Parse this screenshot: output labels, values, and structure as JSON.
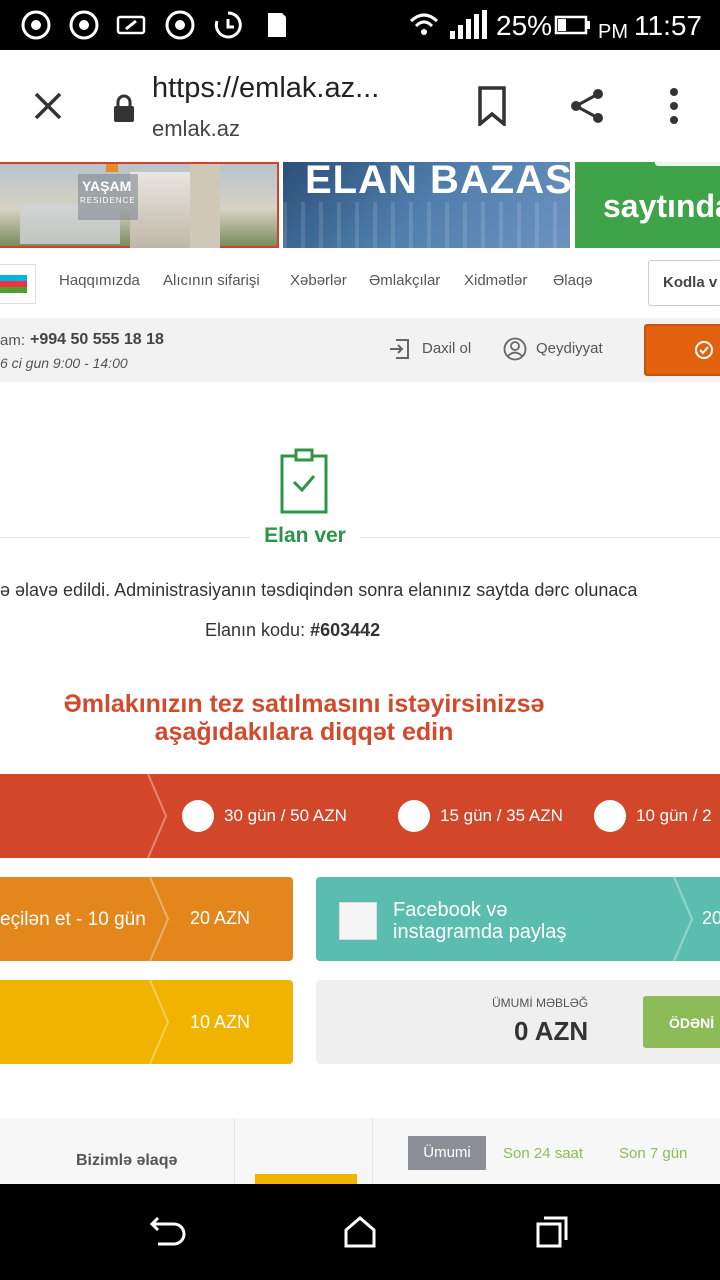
{
  "status_bar": {
    "battery": "25%",
    "ampm": "PM",
    "time": "11:57"
  },
  "browser": {
    "url": "https://emlak.az...",
    "domain": "emlak.az"
  },
  "banners": {
    "banner1_line1": "YAŞAM",
    "banner1_line2": "RESIDENCE",
    "banner2_text": "ELAN BAZASI",
    "banner3_text": "saytında"
  },
  "nav": {
    "items": [
      "Haqqımızda",
      "Alıcının sifarişi",
      "Xəbərlər",
      "Əmlakçılar",
      "Xidmətlər",
      "Əlaqə"
    ],
    "search_placeholder": "Kodla v"
  },
  "info": {
    "phone_prefix": "am:",
    "phone": "+994 50 555 18 18",
    "hours": "6 ci gun 9:00 - 14:00",
    "login": "Daxil ol",
    "register": "Qeydiyyat"
  },
  "success": {
    "title": "Elan ver",
    "message": "ə əlavə edildi. Administrasiyanın təsdiqindən sonra elanınız saytda dərc olunaca",
    "code_label": "Elanın kodu:",
    "code_value": "#603442"
  },
  "promo": {
    "heading_line1": "Əmlakınızın tez satılmasını istəyirsinizsə",
    "heading_line2": "aşağıdakılara diqqət edin",
    "vip_options": [
      "30 gün / 50 AZN",
      "15 gün / 35 AZN",
      "10 gün / 2"
    ],
    "featured_label": "eçilən et - 10 gün",
    "featured_price": "20 AZN",
    "social_label_line1": "Facebook və",
    "social_label_line2": "instagramda paylaş",
    "social_price": "20",
    "yellow_price": "10 AZN",
    "total_label": "ÜMUMİ MƏBLƏĞ",
    "total_value": "0 AZN",
    "pay_button": "ÖDƏNİ"
  },
  "footer": {
    "contact_title": "Bizimlə əlaqə",
    "tabs": [
      "Ümumi",
      "Son 24 saat",
      "Son 7 gün"
    ]
  },
  "colors": {
    "vip_band": "#d2472a",
    "featured_band": "#e3861b",
    "social_band": "#5bbdb0",
    "yellow_band": "#f0b400",
    "pay_button": "#8cbc57",
    "success_green": "#2e9446",
    "heading_red": "#d24a2b"
  }
}
